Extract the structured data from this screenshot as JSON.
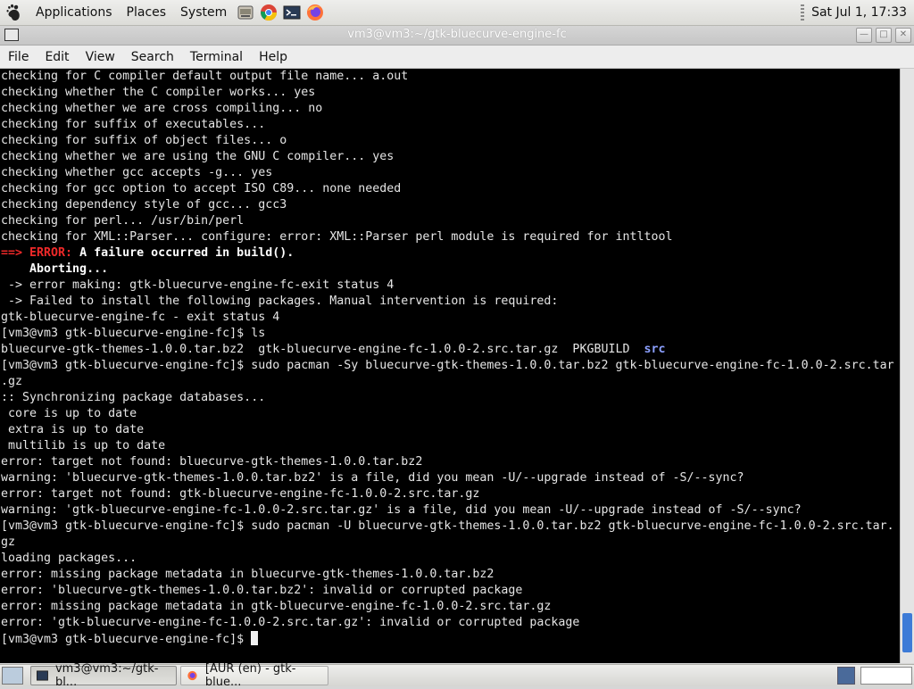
{
  "top_panel": {
    "menus": [
      "Applications",
      "Places",
      "System"
    ],
    "launchers": [
      "file-manager-icon",
      "chrome-icon",
      "terminal-icon",
      "firefox-icon"
    ],
    "clock": "Sat Jul  1, 17:33"
  },
  "window": {
    "title": "vm3@vm3:~/gtk-bluecurve-engine-fc",
    "buttons": {
      "minimize": "—",
      "maximize": "□",
      "close": "✕"
    }
  },
  "menubar": [
    "File",
    "Edit",
    "View",
    "Search",
    "Terminal",
    "Help"
  ],
  "terminal": {
    "lines": [
      [
        {
          "t": "checking for C compiler default output file name... a.out"
        }
      ],
      [
        {
          "t": "checking whether the C compiler works... yes"
        }
      ],
      [
        {
          "t": "checking whether we are cross compiling... no"
        }
      ],
      [
        {
          "t": "checking for suffix of executables..."
        }
      ],
      [
        {
          "t": "checking for suffix of object files... o"
        }
      ],
      [
        {
          "t": "checking whether we are using the GNU C compiler... yes"
        }
      ],
      [
        {
          "t": "checking whether gcc accepts -g... yes"
        }
      ],
      [
        {
          "t": "checking for gcc option to accept ISO C89... none needed"
        }
      ],
      [
        {
          "t": "checking dependency style of gcc... gcc3"
        }
      ],
      [
        {
          "t": "checking for perl... /usr/bin/perl"
        }
      ],
      [
        {
          "t": "checking for XML::Parser... configure: error: XML::Parser perl module is required for intltool"
        }
      ],
      [
        {
          "t": "==> ERROR:",
          "s": "err"
        },
        {
          "t": " A failure occurred in build().",
          "s": "bold"
        }
      ],
      [
        {
          "t": "    Aborting...",
          "s": "bold"
        }
      ],
      [
        {
          "t": " -> error making: gtk-bluecurve-engine-fc-exit status 4"
        }
      ],
      [
        {
          "t": " -> Failed to install the following packages. Manual intervention is required:"
        }
      ],
      [
        {
          "t": "gtk-bluecurve-engine-fc - exit status 4"
        }
      ],
      [
        {
          "t": "[vm3@vm3 gtk-bluecurve-engine-fc]$ ls"
        }
      ],
      [
        {
          "t": "bluecurve-gtk-themes-1.0.0.tar.bz2  gtk-bluecurve-engine-fc-1.0.0-2.src.tar.gz  PKGBUILD  "
        },
        {
          "t": "src",
          "s": "dir"
        }
      ],
      [
        {
          "t": "[vm3@vm3 gtk-bluecurve-engine-fc]$ sudo pacman -Sy bluecurve-gtk-themes-1.0.0.tar.bz2 gtk-bluecurve-engine-fc-1.0.0-2.src.tar"
        }
      ],
      [
        {
          "t": ".gz"
        }
      ],
      [
        {
          "t": ":: Synchronizing package databases..."
        }
      ],
      [
        {
          "t": " core is up to date"
        }
      ],
      [
        {
          "t": " extra is up to date"
        }
      ],
      [
        {
          "t": " multilib is up to date"
        }
      ],
      [
        {
          "t": "error: target not found: bluecurve-gtk-themes-1.0.0.tar.bz2"
        }
      ],
      [
        {
          "t": "warning: 'bluecurve-gtk-themes-1.0.0.tar.bz2' is a file, did you mean -U/--upgrade instead of -S/--sync?"
        }
      ],
      [
        {
          "t": "error: target not found: gtk-bluecurve-engine-fc-1.0.0-2.src.tar.gz"
        }
      ],
      [
        {
          "t": "warning: 'gtk-bluecurve-engine-fc-1.0.0-2.src.tar.gz' is a file, did you mean -U/--upgrade instead of -S/--sync?"
        }
      ],
      [
        {
          "t": "[vm3@vm3 gtk-bluecurve-engine-fc]$ sudo pacman -U bluecurve-gtk-themes-1.0.0.tar.bz2 gtk-bluecurve-engine-fc-1.0.0-2.src.tar."
        }
      ],
      [
        {
          "t": "gz"
        }
      ],
      [
        {
          "t": "loading packages..."
        }
      ],
      [
        {
          "t": "error: missing package metadata in bluecurve-gtk-themes-1.0.0.tar.bz2"
        }
      ],
      [
        {
          "t": "error: 'bluecurve-gtk-themes-1.0.0.tar.bz2': invalid or corrupted package"
        }
      ],
      [
        {
          "t": "error: missing package metadata in gtk-bluecurve-engine-fc-1.0.0-2.src.tar.gz"
        }
      ],
      [
        {
          "t": "error: 'gtk-bluecurve-engine-fc-1.0.0-2.src.tar.gz': invalid or corrupted package"
        }
      ],
      [
        {
          "t": "[vm3@vm3 gtk-bluecurve-engine-fc]$ "
        }
      ]
    ]
  },
  "taskbar": {
    "tasks": [
      {
        "label": "vm3@vm3:~/gtk-bl...",
        "icon": "terminal-icon",
        "active": true
      },
      {
        "label": "[AUR (en) - gtk-blue...",
        "icon": "firefox-icon",
        "active": false
      }
    ]
  },
  "colors": {
    "error_arrow": "#ef2929",
    "directory": "#8ca0ff",
    "scroll_thumb": "#3d7bd7"
  }
}
